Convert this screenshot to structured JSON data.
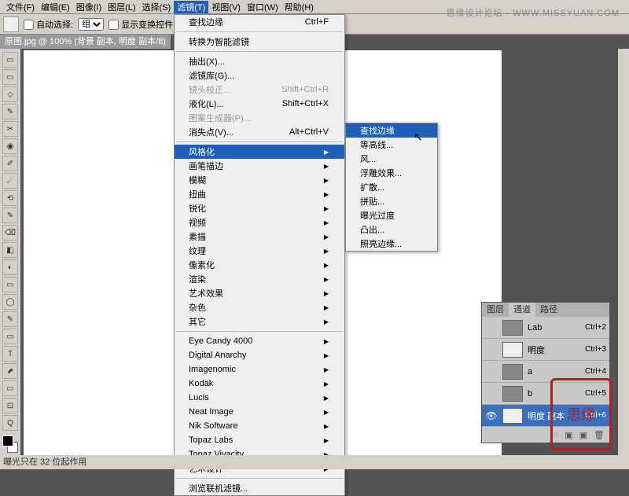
{
  "watermark": "思缘设计论坛 - WWW.MISSYUAN.COM",
  "menubar": [
    "文件(F)",
    "编辑(E)",
    "图像(I)",
    "图层(L)",
    "选择(S)",
    "滤镜(T)",
    "视图(V)",
    "窗口(W)",
    "帮助(H)"
  ],
  "menubar_open_index": 5,
  "options": {
    "auto_select_label": "自动选择:",
    "group_value": "组",
    "show_transform_label": "显示变换控件"
  },
  "doc_tab": "原图.jpg @ 100% (背景 副本, 明度 副本/8)",
  "filter_menu": {
    "top_item": {
      "label": "查找边缘",
      "shortcut": "Ctrl+F"
    },
    "convert": "转换为智能滤镜",
    "group1": [
      {
        "label": "抽出(X)...",
        "shortcut": ""
      },
      {
        "label": "滤镜库(G)...",
        "shortcut": ""
      },
      {
        "label": "镜头校正...",
        "shortcut": "Shift+Ctrl+R",
        "disabled": true
      },
      {
        "label": "液化(L)...",
        "shortcut": "Shift+Ctrl+X"
      },
      {
        "label": "图案生成器(P)...",
        "shortcut": "",
        "disabled": true
      },
      {
        "label": "消失点(V)...",
        "shortcut": "Alt+Ctrl+V"
      }
    ],
    "group2": [
      {
        "label": "风格化",
        "sub": true,
        "hl": true
      },
      {
        "label": "画笔描边",
        "sub": true
      },
      {
        "label": "模糊",
        "sub": true
      },
      {
        "label": "扭曲",
        "sub": true
      },
      {
        "label": "锐化",
        "sub": true
      },
      {
        "label": "视频",
        "sub": true
      },
      {
        "label": "素描",
        "sub": true
      },
      {
        "label": "纹理",
        "sub": true
      },
      {
        "label": "像素化",
        "sub": true
      },
      {
        "label": "渲染",
        "sub": true
      },
      {
        "label": "艺术效果",
        "sub": true
      },
      {
        "label": "杂色",
        "sub": true
      },
      {
        "label": "其它",
        "sub": true
      }
    ],
    "group3": [
      {
        "label": "Eye Candy 4000",
        "sub": true
      },
      {
        "label": "Digital Anarchy",
        "sub": true
      },
      {
        "label": "Imagenomic",
        "sub": true
      },
      {
        "label": "Kodak",
        "sub": true
      },
      {
        "label": "Lucis",
        "sub": true
      },
      {
        "label": "Neat Image",
        "sub": true
      },
      {
        "label": "Nik Software",
        "sub": true
      },
      {
        "label": "Topaz Labs",
        "sub": true
      },
      {
        "label": "Topaz Vivacity",
        "sub": true
      },
      {
        "label": "艺术设计",
        "sub": true
      }
    ],
    "browse": "浏览联机滤镜..."
  },
  "stylize_submenu": [
    {
      "label": "查找边缘",
      "hl": true
    },
    {
      "label": "等高线..."
    },
    {
      "label": "风..."
    },
    {
      "label": "浮雕效果..."
    },
    {
      "label": "扩散..."
    },
    {
      "label": "拼贴..."
    },
    {
      "label": "曝光过度"
    },
    {
      "label": "凸出..."
    },
    {
      "label": "照亮边缘..."
    }
  ],
  "channels": {
    "tabs": [
      "图层",
      "通道",
      "路径"
    ],
    "active_tab": 1,
    "rows": [
      {
        "name": "Lab",
        "shortcut": "Ctrl+2",
        "eye": false
      },
      {
        "name": "明度",
        "shortcut": "Ctrl+3",
        "eye": false,
        "light": true
      },
      {
        "name": "a",
        "shortcut": "Ctrl+4",
        "eye": false
      },
      {
        "name": "b",
        "shortcut": "Ctrl+5",
        "eye": false
      },
      {
        "name": "明度 副本",
        "shortcut": "Ctrl+6",
        "eye": true,
        "selected": true,
        "light": true
      }
    ]
  },
  "tools": [
    "▭",
    "▭",
    "⬦",
    "✎",
    "✂",
    "◉",
    "✐",
    "☄",
    "⟲",
    "✎",
    "⌫",
    "◧",
    "◐",
    "▭",
    "◯",
    "✎",
    "▭",
    "T",
    "⬈",
    "▭",
    "⊡",
    "Q"
  ],
  "statusbar": "曝光只在 32 位起作用",
  "stamp": "思缘"
}
